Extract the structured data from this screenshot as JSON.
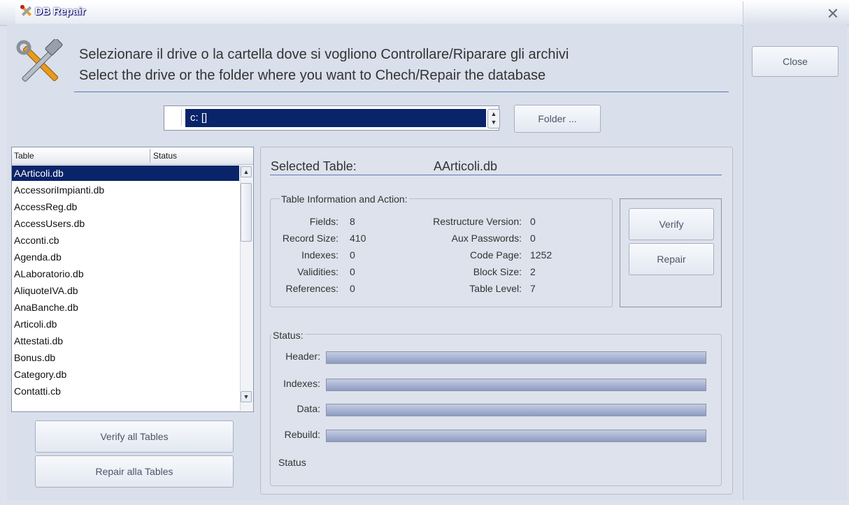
{
  "window": {
    "title": "DB Repair"
  },
  "header": {
    "instruction_it": "Selezionare il drive o la cartella dove si vogliono Controllare/Riparare gli archivi",
    "instruction_en": "Select the drive or the folder where you want to Chech/Repair the database"
  },
  "drive": {
    "selected": "c: []",
    "folder_button": "Folder ..."
  },
  "right_panel": {
    "close_button": "Close"
  },
  "table_list": {
    "columns": [
      "Table",
      "Status"
    ],
    "rows": [
      "AArticoli.db",
      "AccessoriImpianti.db",
      "AccessReg.db",
      "AccessUsers.db",
      "Acconti.cb",
      "Agenda.db",
      "ALaboratorio.db",
      "AliquoteIVA.db",
      "AnaBanche.db",
      "Articoli.db",
      "Attestati.db",
      "Bonus.db",
      "Category.db",
      "Contatti.cb"
    ],
    "selected_index": 0
  },
  "bulk_actions": {
    "verify_all": "Verify all Tables",
    "repair_all": "Repair alla Tables"
  },
  "selected_table": {
    "label": "Selected Table:",
    "value": "AArticoli.db"
  },
  "table_info": {
    "title": "Table Information and Action:",
    "left": [
      {
        "label": "Fields:",
        "value": "8"
      },
      {
        "label": "Record Size:",
        "value": "410"
      },
      {
        "label": "Indexes:",
        "value": "0"
      },
      {
        "label": "Validities:",
        "value": "0"
      },
      {
        "label": "References:",
        "value": "0"
      }
    ],
    "right": [
      {
        "label": "Restructure Version:",
        "value": "0"
      },
      {
        "label": "Aux Passwords:",
        "value": "0"
      },
      {
        "label": "Code Page:",
        "value": "1252"
      },
      {
        "label": "Block Size:",
        "value": "2"
      },
      {
        "label": "Table Level:",
        "value": "7"
      }
    ],
    "verify_button": "Verify",
    "repair_button": "Repair"
  },
  "status": {
    "title": "Status:",
    "bars": [
      {
        "label": "Header:",
        "progress": 1.0
      },
      {
        "label": "Indexes:",
        "progress": 1.0
      },
      {
        "label": "Data:",
        "progress": 1.0
      },
      {
        "label": "Rebuild:",
        "progress": 1.0
      }
    ],
    "text": "Status"
  }
}
